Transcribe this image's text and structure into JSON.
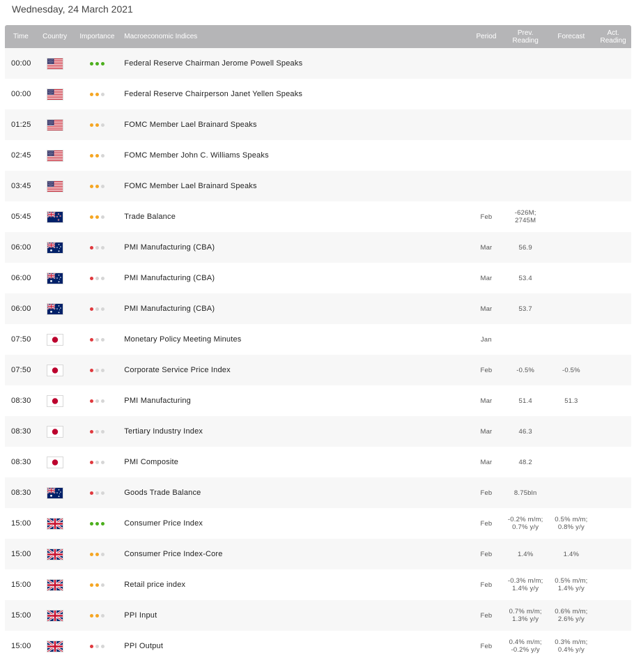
{
  "page": {
    "date_title": "Wednesday, 24 March 2021"
  },
  "columns": {
    "time": "Time",
    "country": "Country",
    "importance": "Importance",
    "index": "Macroeconomic Indices",
    "period": "Period",
    "prev": "Prev.\nReading",
    "forecast": "Forecast",
    "actual": "Act.\nReading"
  },
  "importance_colors": {
    "high": "#4caf1d",
    "medium": "#f5a623",
    "low": "#e0393e",
    "off": "#d6d6d6"
  },
  "rows": [
    {
      "time": "00:00",
      "country": "us-flag-icon",
      "importance": "high",
      "name": "Federal Reserve Chairman Jerome Powell Speaks",
      "period": "",
      "prev": "",
      "forecast": "",
      "actual": ""
    },
    {
      "time": "00:00",
      "country": "us-flag-icon",
      "importance": "medium",
      "name": "Federal Reserve Chairperson Janet Yellen Speaks",
      "period": "",
      "prev": "",
      "forecast": "",
      "actual": ""
    },
    {
      "time": "01:25",
      "country": "us-flag-icon",
      "importance": "medium",
      "name": "FOMC Member Lael Brainard Speaks",
      "period": "",
      "prev": "",
      "forecast": "",
      "actual": ""
    },
    {
      "time": "02:45",
      "country": "us-flag-icon",
      "importance": "medium",
      "name": "FOMC Member John C. Williams Speaks",
      "period": "",
      "prev": "",
      "forecast": "",
      "actual": ""
    },
    {
      "time": "03:45",
      "country": "us-flag-icon",
      "importance": "medium",
      "name": "FOMC Member Lael Brainard Speaks",
      "period": "",
      "prev": "",
      "forecast": "",
      "actual": ""
    },
    {
      "time": "05:45",
      "country": "nz-flag-icon",
      "importance": "medium",
      "name": "Trade Balance",
      "period": "Feb",
      "prev": "-626M;\n2745M",
      "forecast": "",
      "actual": ""
    },
    {
      "time": "06:00",
      "country": "au-flag-icon",
      "importance": "low",
      "name": "PMI Manufacturing (CBA)",
      "period": "Mar",
      "prev": "56.9",
      "forecast": "",
      "actual": ""
    },
    {
      "time": "06:00",
      "country": "au-flag-icon",
      "importance": "low",
      "name": "PMI Manufacturing (CBA)",
      "period": "Mar",
      "prev": "53.4",
      "forecast": "",
      "actual": ""
    },
    {
      "time": "06:00",
      "country": "au-flag-icon",
      "importance": "low",
      "name": "PMI Manufacturing (CBA)",
      "period": "Mar",
      "prev": "53.7",
      "forecast": "",
      "actual": ""
    },
    {
      "time": "07:50",
      "country": "jp-flag-icon",
      "importance": "low",
      "name": "Monetary Policy Meeting Minutes",
      "period": "Jan",
      "prev": "",
      "forecast": "",
      "actual": ""
    },
    {
      "time": "07:50",
      "country": "jp-flag-icon",
      "importance": "low",
      "name": "Corporate Service Price Index",
      "period": "Feb",
      "prev": "-0.5%",
      "forecast": "-0.5%",
      "actual": ""
    },
    {
      "time": "08:30",
      "country": "jp-flag-icon",
      "importance": "low",
      "name": "PMI Manufacturing",
      "period": "Mar",
      "prev": "51.4",
      "forecast": "51.3",
      "actual": ""
    },
    {
      "time": "08:30",
      "country": "jp-flag-icon",
      "importance": "low",
      "name": "Tertiary Industry Index",
      "period": "Mar",
      "prev": "46.3",
      "forecast": "",
      "actual": ""
    },
    {
      "time": "08:30",
      "country": "jp-flag-icon",
      "importance": "low",
      "name": "PMI Composite",
      "period": "Mar",
      "prev": "48.2",
      "forecast": "",
      "actual": ""
    },
    {
      "time": "08:30",
      "country": "au-flag-icon",
      "importance": "low",
      "name": "Goods Trade Balance",
      "period": "Feb",
      "prev": "8.75bln",
      "forecast": "",
      "actual": ""
    },
    {
      "time": "15:00",
      "country": "uk-flag-icon",
      "importance": "high",
      "name": "Consumer Price Index",
      "period": "Feb",
      "prev": "-0.2% m/m;\n0.7% y/y",
      "forecast": "0.5% m/m;\n0.8% y/y",
      "actual": ""
    },
    {
      "time": "15:00",
      "country": "uk-flag-icon",
      "importance": "medium",
      "name": "Consumer Price Index-Core",
      "period": "Feb",
      "prev": "1.4%",
      "forecast": "1.4%",
      "actual": ""
    },
    {
      "time": "15:00",
      "country": "uk-flag-icon",
      "importance": "medium",
      "name": "Retail price index",
      "period": "Feb",
      "prev": "-0.3% m/m;\n1.4% y/y",
      "forecast": "0.5% m/m;\n1.4% y/y",
      "actual": ""
    },
    {
      "time": "15:00",
      "country": "uk-flag-icon",
      "importance": "medium",
      "name": "PPI Input",
      "period": "Feb",
      "prev": "0.7% m/m;\n1.3% y/y",
      "forecast": "0.6% m/m;\n2.6% y/y",
      "actual": ""
    },
    {
      "time": "15:00",
      "country": "uk-flag-icon",
      "importance": "low",
      "name": "PPI Output",
      "period": "Feb",
      "prev": "0.4% m/m;\n-0.2% y/y",
      "forecast": "0.3% m/m;\n0.4% y/y",
      "actual": ""
    }
  ]
}
